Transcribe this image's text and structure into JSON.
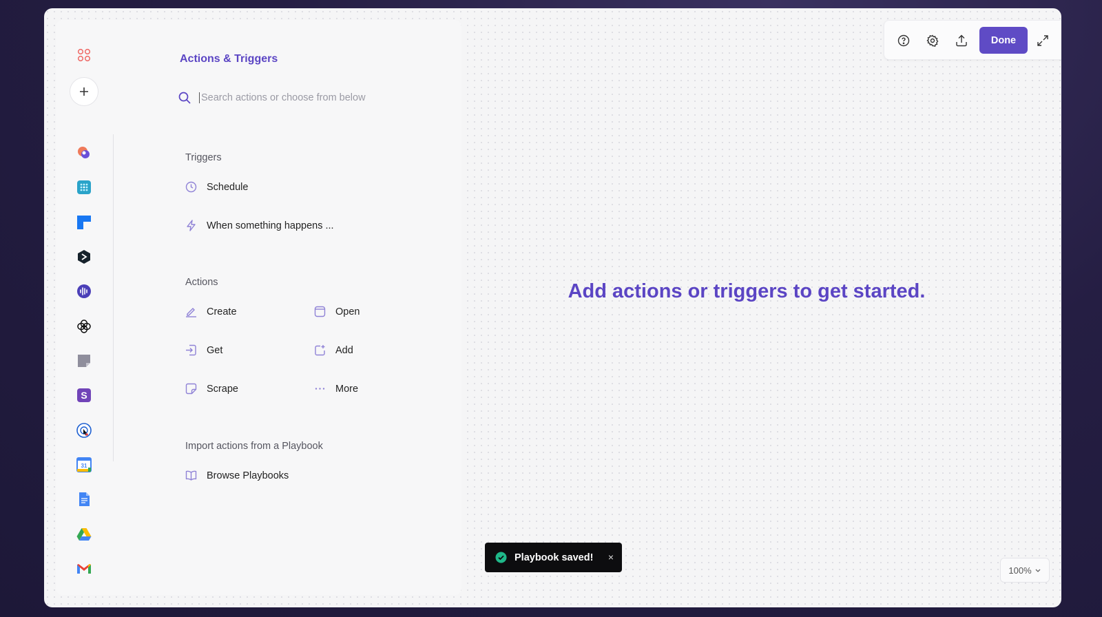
{
  "panel": {
    "title": "Actions & Triggers",
    "search_placeholder": "Search actions or choose from below",
    "triggers_label": "Triggers",
    "triggers": [
      {
        "label": "Schedule",
        "icon": "clock-icon"
      },
      {
        "label": "When something happens ...",
        "icon": "lightning-icon"
      }
    ],
    "actions_label": "Actions",
    "actions": [
      {
        "label": "Create",
        "icon": "pen-icon"
      },
      {
        "label": "Open",
        "icon": "window-icon"
      },
      {
        "label": "Get",
        "icon": "import-icon"
      },
      {
        "label": "Add",
        "icon": "add-box-icon"
      },
      {
        "label": "Scrape",
        "icon": "scrape-icon"
      },
      {
        "label": "More",
        "icon": "ellipsis-icon"
      }
    ],
    "import_label": "Import actions from a Playbook",
    "browse_label": "Browse Playbooks"
  },
  "rail": {
    "apps": [
      "apps-grid-icon",
      "add-app-icon",
      "microsoft-loop-icon",
      "airtable-icon",
      "linear-icon",
      "perplexity-icon",
      "voice-app-icon",
      "openai-icon",
      "sticky-note-icon",
      "s-app-icon",
      "web-scraper-icon",
      "google-calendar-icon",
      "google-docs-icon",
      "google-drive-icon",
      "gmail-icon"
    ],
    "calendar_day": "31"
  },
  "canvas": {
    "hint": "Add actions or triggers to get started.",
    "zoom": "100%"
  },
  "toolbar": {
    "done_label": "Done"
  },
  "toast": {
    "message": "Playbook saved!",
    "close": "×"
  },
  "colors": {
    "accent": "#5f4bc5",
    "accent_text": "#5b45c4",
    "toast_bg": "#0d0d0f",
    "success": "#1fb889"
  }
}
